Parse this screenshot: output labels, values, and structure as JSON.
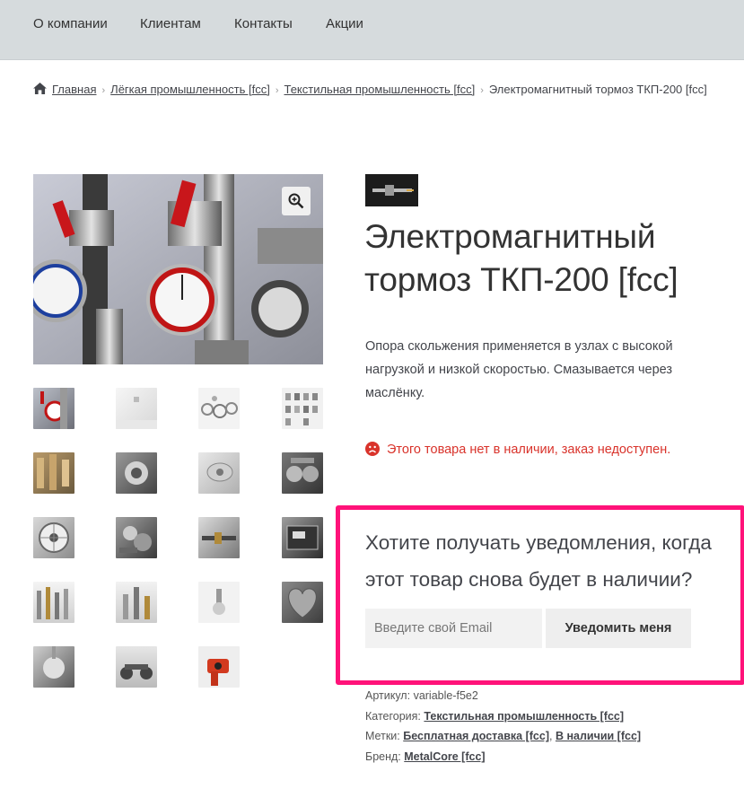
{
  "nav": {
    "items": [
      {
        "label": "О компании"
      },
      {
        "label": "Клиентам"
      },
      {
        "label": "Контакты"
      },
      {
        "label": "Акции"
      }
    ]
  },
  "breadcrumb": {
    "home": "Главная",
    "level1": "Лёгкая промышленность [fcc]",
    "level2": "Текстильная промышленность [fcc]",
    "current": "Электромагнитный тормоз ТКП-200 [fcc]"
  },
  "product": {
    "title_line1": "Электромагнитный",
    "title_line2": "тормоз ТКП-200 [fcc]",
    "description": "Опора скольжения применяется в узлах с высокой нагрузкой и низкой скоростью. Смазывается через маслёнку.",
    "stock_message": "Этого товара нет в наличии, заказ недоступен."
  },
  "notify": {
    "title": "Хотите получать уведомления, когда этот товар снова будет в наличии?",
    "email_placeholder": "Введите свой Email",
    "button_label": "Уведомить меня"
  },
  "meta": {
    "sku_label": "Артикул:",
    "sku_value": "variable-f5e2",
    "category_label": "Категория:",
    "category_value": "Текстильная промышленность [fcc]",
    "tags_label": "Метки:",
    "tag1": "Бесплатная доставка [fcc]",
    "tag2": "В наличии [fcc]",
    "brand_label": "Бренд:",
    "brand_value": "MetalCore [fcc]"
  },
  "colors": {
    "nav_bg": "#d6dbdd",
    "stock_red": "#d9332b",
    "highlight_pink": "#ff1279"
  },
  "icons": [
    "home-icon",
    "sad-face-icon",
    "zoom-in-icon"
  ]
}
